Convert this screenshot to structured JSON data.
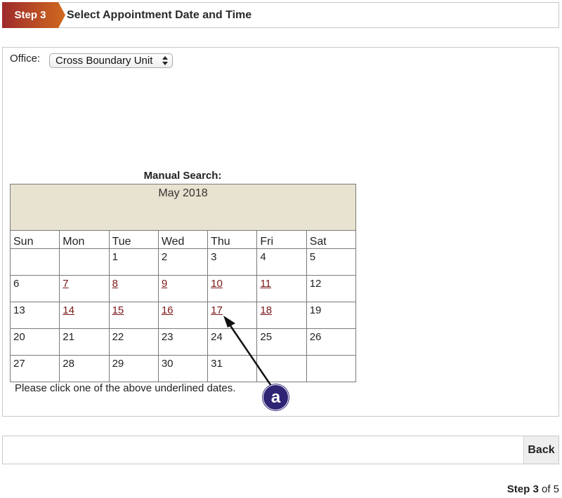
{
  "step_header": {
    "badge": "Step 3",
    "title": "Select Appointment Date and Time",
    "badge_color_start": "#9e2a2b",
    "badge_color_end": "#cf6a1f"
  },
  "office": {
    "label": "Office:",
    "selected": "Cross Boundary Unit"
  },
  "manual_search": {
    "title": "Manual Search:",
    "month": "May 2018",
    "weekdays": [
      "Sun",
      "Mon",
      "Tue",
      "Wed",
      "Thu",
      "Fri",
      "Sat"
    ],
    "weeks": [
      [
        {
          "d": ""
        },
        {
          "d": ""
        },
        {
          "d": "1"
        },
        {
          "d": "2"
        },
        {
          "d": "3"
        },
        {
          "d": "4"
        },
        {
          "d": "5"
        }
      ],
      [
        {
          "d": "6"
        },
        {
          "d": "7",
          "link": true
        },
        {
          "d": "8",
          "link": true
        },
        {
          "d": "9",
          "link": true
        },
        {
          "d": "10",
          "link": true
        },
        {
          "d": "11",
          "link": true
        },
        {
          "d": "12"
        }
      ],
      [
        {
          "d": "13"
        },
        {
          "d": "14",
          "link": true
        },
        {
          "d": "15",
          "link": true
        },
        {
          "d": "16",
          "link": true
        },
        {
          "d": "17",
          "link": true
        },
        {
          "d": "18",
          "link": true
        },
        {
          "d": "19"
        }
      ],
      [
        {
          "d": "20"
        },
        {
          "d": "21"
        },
        {
          "d": "22"
        },
        {
          "d": "23"
        },
        {
          "d": "24"
        },
        {
          "d": "25"
        },
        {
          "d": "26"
        }
      ],
      [
        {
          "d": "27"
        },
        {
          "d": "28"
        },
        {
          "d": "29"
        },
        {
          "d": "30"
        },
        {
          "d": "31"
        },
        {
          "d": ""
        },
        {
          "d": ""
        }
      ]
    ],
    "note": "Please click one of the above underlined dates.",
    "header_bg": "#e8e2d0",
    "link_color": "#7a1717"
  },
  "annotation": {
    "label": "a",
    "color": "#2e2474"
  },
  "nav": {
    "back_label": "Back"
  },
  "progress": {
    "step_word": "Step 3",
    "rest": " of 5"
  }
}
